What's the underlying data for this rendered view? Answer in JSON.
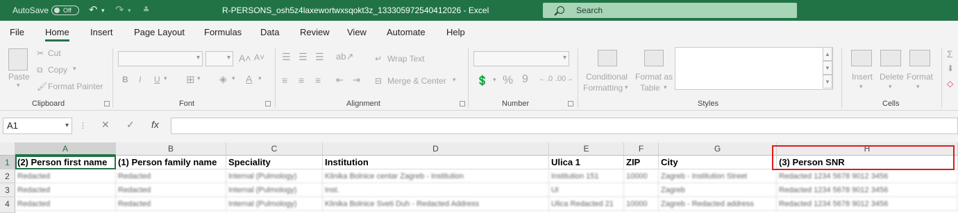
{
  "titlebar": {
    "autosave_label": "AutoSave",
    "autosave_state": "Off",
    "filename": "R-PERSONS_osh5z4laxewortwxsqokt3z_133305972540412026",
    "app": "Excel",
    "search_placeholder": "Search"
  },
  "tabs": [
    "File",
    "Home",
    "Insert",
    "Page Layout",
    "Formulas",
    "Data",
    "Review",
    "View",
    "Automate",
    "Help"
  ],
  "active_tab": "Home",
  "ribbon": {
    "clipboard": {
      "paste": "Paste",
      "cut": "Cut",
      "copy": "Copy",
      "format_painter": "Format Painter",
      "label": "Clipboard"
    },
    "font": {
      "label": "Font",
      "bold": "B",
      "italic": "I",
      "underline": "U"
    },
    "alignment": {
      "wrap_text": "Wrap Text",
      "merge_center": "Merge & Center",
      "label": "Alignment"
    },
    "number": {
      "label": "Number",
      "percent": "%",
      "comma": "9"
    },
    "styles": {
      "conditional": "Conditional",
      "conditional2": "Formatting",
      "format_as": "Format as",
      "format_as2": "Table",
      "label": "Styles"
    },
    "cells": {
      "insert": "Insert",
      "delete": "Delete",
      "format": "Format",
      "label": "Cells"
    }
  },
  "formula_bar": {
    "name_box": "A1",
    "fx": "fx",
    "value": ""
  },
  "sheet": {
    "columns": [
      "A",
      "B",
      "C",
      "D",
      "E",
      "F",
      "G",
      "H"
    ],
    "rows": [
      "1",
      "2",
      "3",
      "4"
    ],
    "header_row": [
      "(2) Person first name",
      "(1) Person family name",
      "Speciality",
      "Institution",
      "Ulica 1",
      "ZIP",
      "City",
      "(3) Person SNR"
    ],
    "data_rows": [
      [
        "Redacted",
        "Redacted",
        "Internal (Pulmology)",
        "Klinika Bolnice centar Zagreb - Institution",
        "Institution 151",
        "10000",
        "Zagreb - Institution Street",
        "Redacted 1234 5678 9012 3456"
      ],
      [
        "Redacted",
        "Redacted",
        "Internal (Pulmology)",
        "Inst.",
        "Ul",
        "",
        "Zagreb",
        "Redacted 1234 5678 9012 3456"
      ],
      [
        "Redacted",
        "Redacted",
        "Internal (Pulmology)",
        "Klinika Bolnice Sveti Duh - Redacted Address",
        "Ulica Redacted 21",
        "10000",
        "Zagreb - Redacted address",
        "Redacted 1234 5678 9012 3456"
      ]
    ]
  }
}
